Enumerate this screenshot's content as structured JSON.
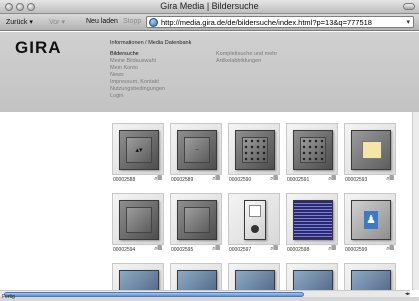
{
  "window": {
    "title": "Gira Media | Bildersuche"
  },
  "toolbar": {
    "back": "Zurück",
    "forward": "Vor",
    "reload": "Neu laden",
    "stop": "Stopp",
    "url": "http://media.gira.de/de/bildersuche/index.html?p=13&q=777518"
  },
  "header": {
    "logo": "GIRA",
    "breadcrumb": "Informationen / Media Datenbank",
    "nav_left": [
      "Bildersuche",
      "Meine Bildauswahl",
      "Mein Konto",
      "News",
      "Impressum, Kontakt",
      "Nutzungsbedingungen",
      "Login"
    ],
    "nav_right": [
      "Komplettsuche und mehr",
      "Artikelabbildungen"
    ]
  },
  "tiles": [
    {
      "id": "00002588",
      "icon": "double-arrow-switch"
    },
    {
      "id": "00002589",
      "icon": "blind-switch"
    },
    {
      "id": "00002590",
      "icon": "keypad-dots"
    },
    {
      "id": "00002591",
      "icon": "keypad-dots"
    },
    {
      "id": "00002593",
      "icon": "card-switch"
    },
    {
      "id": "00002594",
      "icon": "plain-rocker"
    },
    {
      "id": "00002595",
      "icon": "plain-rocker"
    },
    {
      "id": "00002597",
      "icon": "socket-combination"
    },
    {
      "id": "00002598",
      "icon": "louvre-vent"
    },
    {
      "id": "00002599",
      "icon": "person-symbol"
    },
    {
      "id": "",
      "icon": "partial"
    },
    {
      "id": "",
      "icon": "partial"
    },
    {
      "id": "",
      "icon": "partial"
    },
    {
      "id": "",
      "icon": "partial"
    },
    {
      "id": "",
      "icon": "partial"
    }
  ],
  "status": {
    "text": "Fertig"
  },
  "colors": {
    "header_bg": "#c8c8c8",
    "accent": "#5b8fd3"
  }
}
